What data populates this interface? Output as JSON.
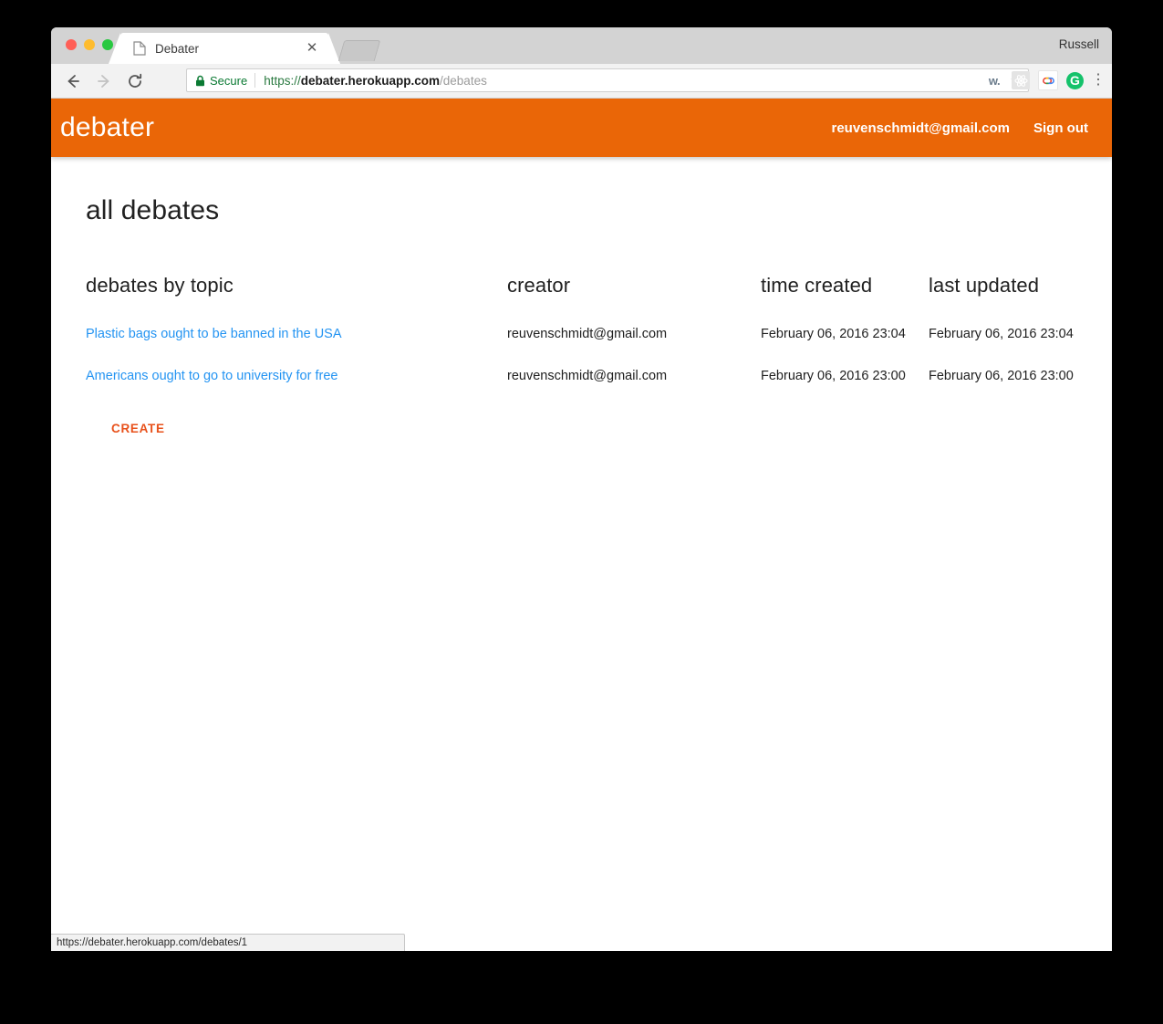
{
  "browser": {
    "profile_name": "Russell",
    "tab": {
      "title": "Debater",
      "favicon_icon": "document-icon",
      "close_icon": "close-icon"
    },
    "newtab_icon": "new-tab-button",
    "nav": {
      "back_icon": "back-arrow-icon",
      "forward_icon": "forward-arrow-icon",
      "reload_icon": "reload-icon"
    },
    "omnibox": {
      "lock_icon": "lock-icon",
      "secure_label": "Secure",
      "url_scheme": "https://",
      "url_host": "debater.herokuapp.com",
      "url_path": "/debates",
      "full_url": "https://debater.herokuapp.com/debates",
      "bookmark_icon": "star-icon"
    },
    "extensions": [
      {
        "name": "wikiwand-extension-icon",
        "glyph": "w."
      },
      {
        "name": "react-devtools-extension-icon",
        "glyph": "⚛"
      },
      {
        "name": "google-extension-icon",
        "glyph": "●"
      },
      {
        "name": "grammarly-extension-icon",
        "glyph": "G"
      },
      {
        "name": "chrome-menu-icon",
        "glyph": "⋮"
      }
    ],
    "status_bubble": {
      "url": "https://debater.herokuapp.com/debates/1"
    }
  },
  "app": {
    "brand": "debater",
    "user_email": "reuvenschmidt@gmail.com",
    "sign_out_label": "Sign out",
    "page_title": "all debates",
    "create_label": "CREATE",
    "accent_color": "#ea6607",
    "link_color": "#2494f2",
    "create_color": "#e8511b",
    "table": {
      "columns": [
        "debates by topic",
        "creator",
        "time created",
        "last updated"
      ],
      "rows": [
        {
          "topic": "Plastic bags ought to be banned in the USA",
          "creator": "reuvenschmidt@gmail.com",
          "time_created": "February 06, 2016 23:04",
          "last_updated": "February 06, 2016 23:04"
        },
        {
          "topic": "Americans ought to go to university for free",
          "creator": "reuvenschmidt@gmail.com",
          "time_created": "February 06, 2016 23:00",
          "last_updated": "February 06, 2016 23:00"
        }
      ]
    }
  }
}
